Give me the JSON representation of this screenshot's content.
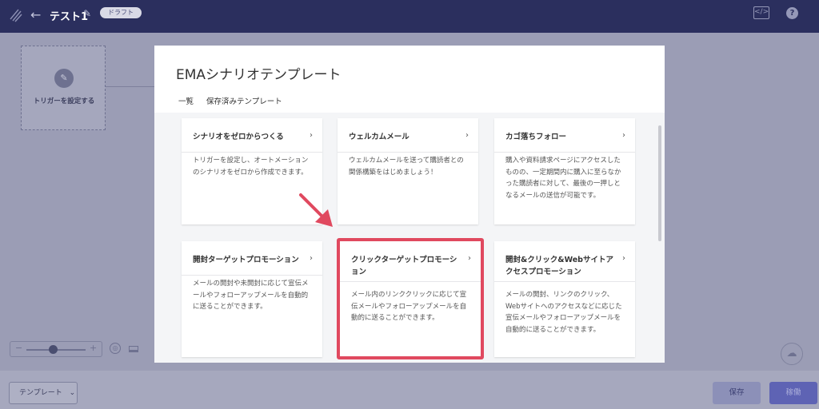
{
  "header": {
    "title": "テスト1",
    "badge": "ドラフト",
    "code_icon_glyph": "</>",
    "help_glyph": "?",
    "back_glyph": "←",
    "pencil_glyph": "✎"
  },
  "canvas": {
    "trigger_label": "トリガーを設定する",
    "trigger_icon_glyph": "✎",
    "zoom_minus": "−",
    "zoom_plus": "+",
    "zoom_level": 0.45,
    "cloud_glyph": "☁"
  },
  "bottom": {
    "template_button": "テンプレート",
    "template_chevron": "⌄",
    "save_button": "保存",
    "move_button": "稼働"
  },
  "modal": {
    "title": "EMAシナリオテンプレート",
    "tabs": [
      {
        "label": "一覧",
        "active": true
      },
      {
        "label": "保存済みテンプレート",
        "active": false
      }
    ],
    "cards": [
      {
        "title": "シナリオをゼロからつくる",
        "description": "トリガーを設定し、オートメーションのシナリオをゼロから作成できます。"
      },
      {
        "title": "ウェルカムメール",
        "description": "ウェルカムメールを送って購読者との関係構築をはじめましょう！"
      },
      {
        "title": "カゴ落ちフォロー",
        "description": "購入や資料請求ページにアクセスしたものの、一定期間内に購入に至らなかった購読者に対して、最後の一押しとなるメールの送信が可能です。"
      },
      {
        "title": "開封ターゲットプロモーション",
        "description": "メールの開封や未開封に応じて宣伝メールやフォローアップメールを自動的に送ることができます。"
      },
      {
        "title": "クリックターゲットプロモーション",
        "description": "メール内のリンククリックに応じて宣伝メールやフォローアップメールを自動的に送ることができます。"
      },
      {
        "title": "開封&クリック&Webサイトアクセスプロモーション",
        "description": "メールの開封、リンクのクリック、Webサイトへのアクセスなどに応じた宣伝メールやフォローアップメールを自動的に送ることができます。"
      }
    ],
    "chevron_glyph": "›"
  },
  "colors": {
    "header_bg": "#2b2f5e",
    "accent_tab": "#4aa8a0",
    "highlight": "#e0495f",
    "move_button": "#5e63b4"
  }
}
